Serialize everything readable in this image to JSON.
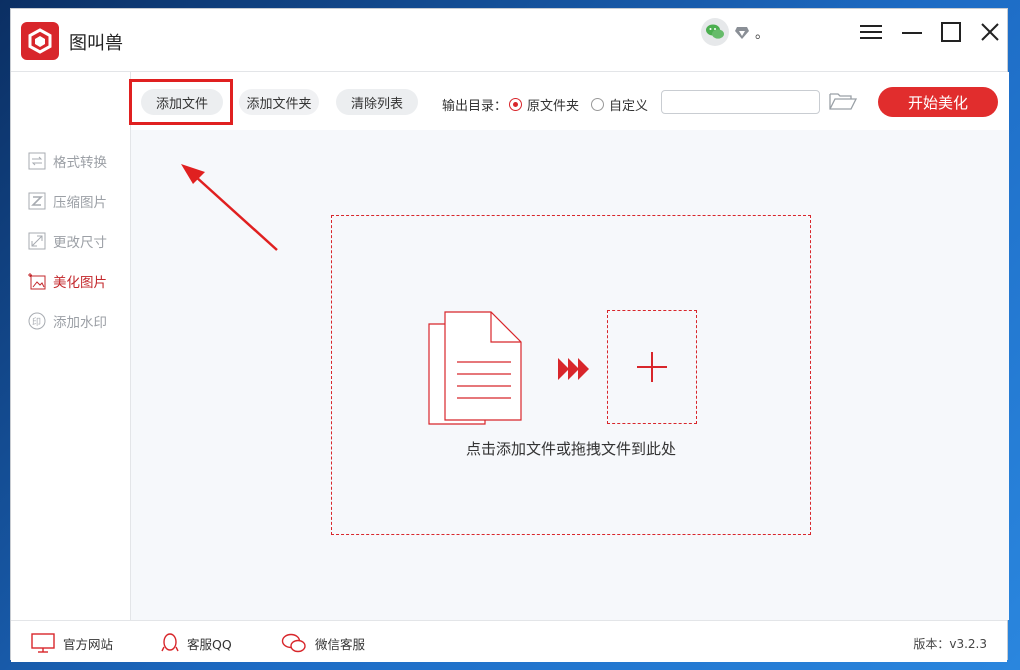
{
  "app": {
    "title": "图叫兽",
    "dot_text": "。"
  },
  "toolbar": {
    "add_file_label": "添加文件",
    "add_folder_label": "添加文件夹",
    "clear_list_label": "清除列表",
    "output_dir_label": "输出目录：",
    "radio_original_label": "原文件夹",
    "radio_custom_label": "自定义",
    "radio_selected": "原文件夹",
    "path_value": "",
    "start_label": "开始美化"
  },
  "sidebar": {
    "items": [
      {
        "label": "格式转换",
        "icon": "format-convert-icon",
        "active": false
      },
      {
        "label": "压缩图片",
        "icon": "compress-icon",
        "active": false
      },
      {
        "label": "更改尺寸",
        "icon": "resize-icon",
        "active": false
      },
      {
        "label": "美化图片",
        "icon": "beautify-icon",
        "active": true
      },
      {
        "label": "添加水印",
        "icon": "watermark-icon",
        "active": false
      }
    ]
  },
  "main": {
    "drop_hint": "点击添加文件或拖拽文件到此处"
  },
  "footer": {
    "website_label": "官方网站",
    "qq_label": "客服QQ",
    "wechat_label": "微信客服",
    "version_label": "版本：v3.2.3"
  },
  "colors": {
    "accent": "#d8262b",
    "start_button": "#e12d2d",
    "highlight": "#e02020"
  }
}
